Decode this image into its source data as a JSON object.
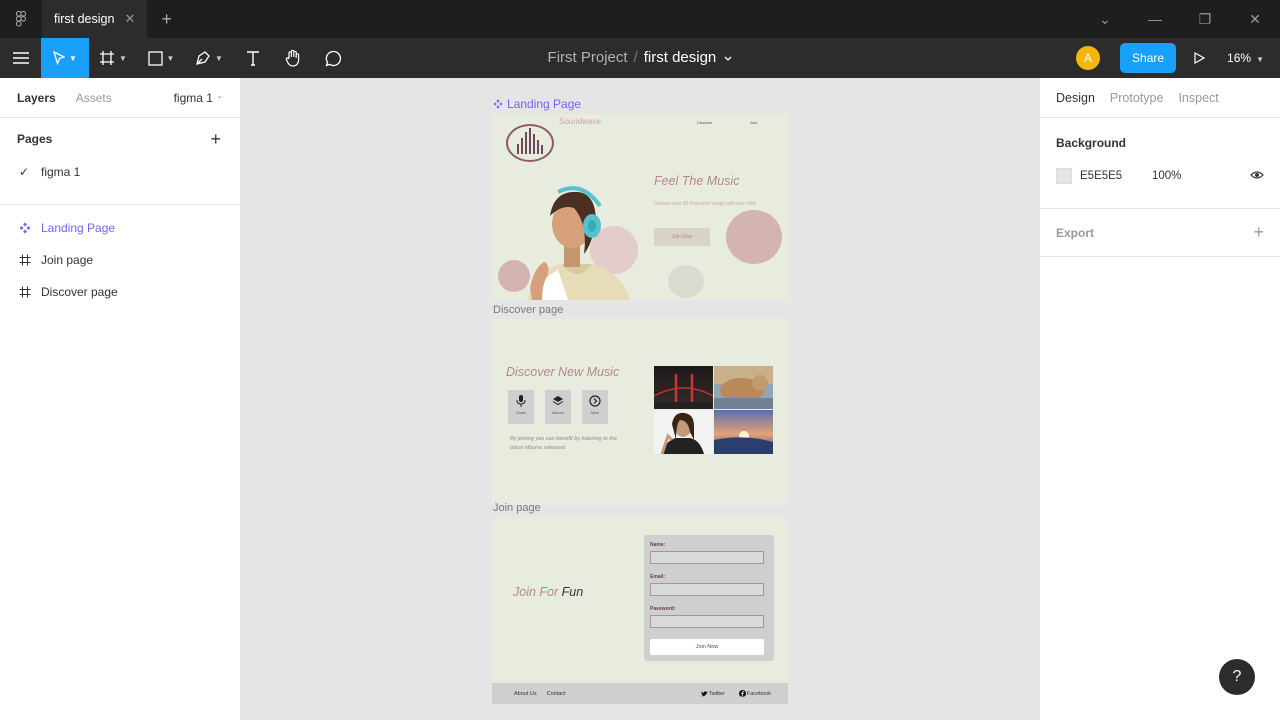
{
  "window": {
    "tab_title": "first design",
    "tab_close": "✕",
    "new_tab": "+",
    "controls": {
      "collapse": "⌄",
      "minimize": "—",
      "restore": "❐",
      "close": "✕"
    }
  },
  "toolbar": {
    "breadcrumb_project": "First Project",
    "breadcrumb_sep": "/",
    "breadcrumb_file": "first design",
    "avatar_initial": "A",
    "share_label": "Share",
    "zoom_label": "16%"
  },
  "left_panel": {
    "tab_layers": "Layers",
    "tab_assets": "Assets",
    "page_switch": "figma 1",
    "pages_header": "Pages",
    "add_symbol": "+",
    "pages": [
      {
        "label": "figma 1",
        "check": "✓"
      }
    ],
    "layers": [
      {
        "label": "Landing Page",
        "icon": "component-icon",
        "selected": true
      },
      {
        "label": "Join page",
        "icon": "frame-icon",
        "selected": false
      },
      {
        "label": "Discover page",
        "icon": "frame-icon",
        "selected": false
      }
    ]
  },
  "right_panel": {
    "tab_design": "Design",
    "tab_prototype": "Prototype",
    "tab_inspect": "Inspect",
    "background_title": "Background",
    "background_hex": "E5E5E5",
    "background_opacity": "100%",
    "export_title": "Export",
    "add_symbol": "+"
  },
  "canvas": {
    "landing": {
      "label": "Landing Page",
      "brand": "Soundwave",
      "nav_discover": "Discover",
      "nav_join": "Join",
      "title": "Feel The Music",
      "subtitle": "Stream over 30 thousand songs with one click",
      "button": "Join Now"
    },
    "discover": {
      "label": "Discover page",
      "title": "Discover New Music",
      "cards": [
        "Charts",
        "Albums",
        "More"
      ],
      "text": "By joining you can benefit by listening to the latest albums released"
    },
    "join": {
      "label": "Join page",
      "title_accent": "Join For",
      "title_dark": "Fun",
      "name_label": "Name:",
      "email_label": "Email:",
      "password_label": "Password:",
      "submit": "Join Now"
    },
    "footer": {
      "about": "About Us",
      "contact": "Contact",
      "twitter": "Twitter",
      "facebook": "Facebook"
    }
  },
  "help_label": "?",
  "colors": {
    "accent_blue": "#18A0FB",
    "component_purple": "#7B61FF",
    "canvas_bg": "#E5E5E5",
    "frame_bg": "#E8ECDF",
    "pink_circle": "#D4B3B3"
  }
}
